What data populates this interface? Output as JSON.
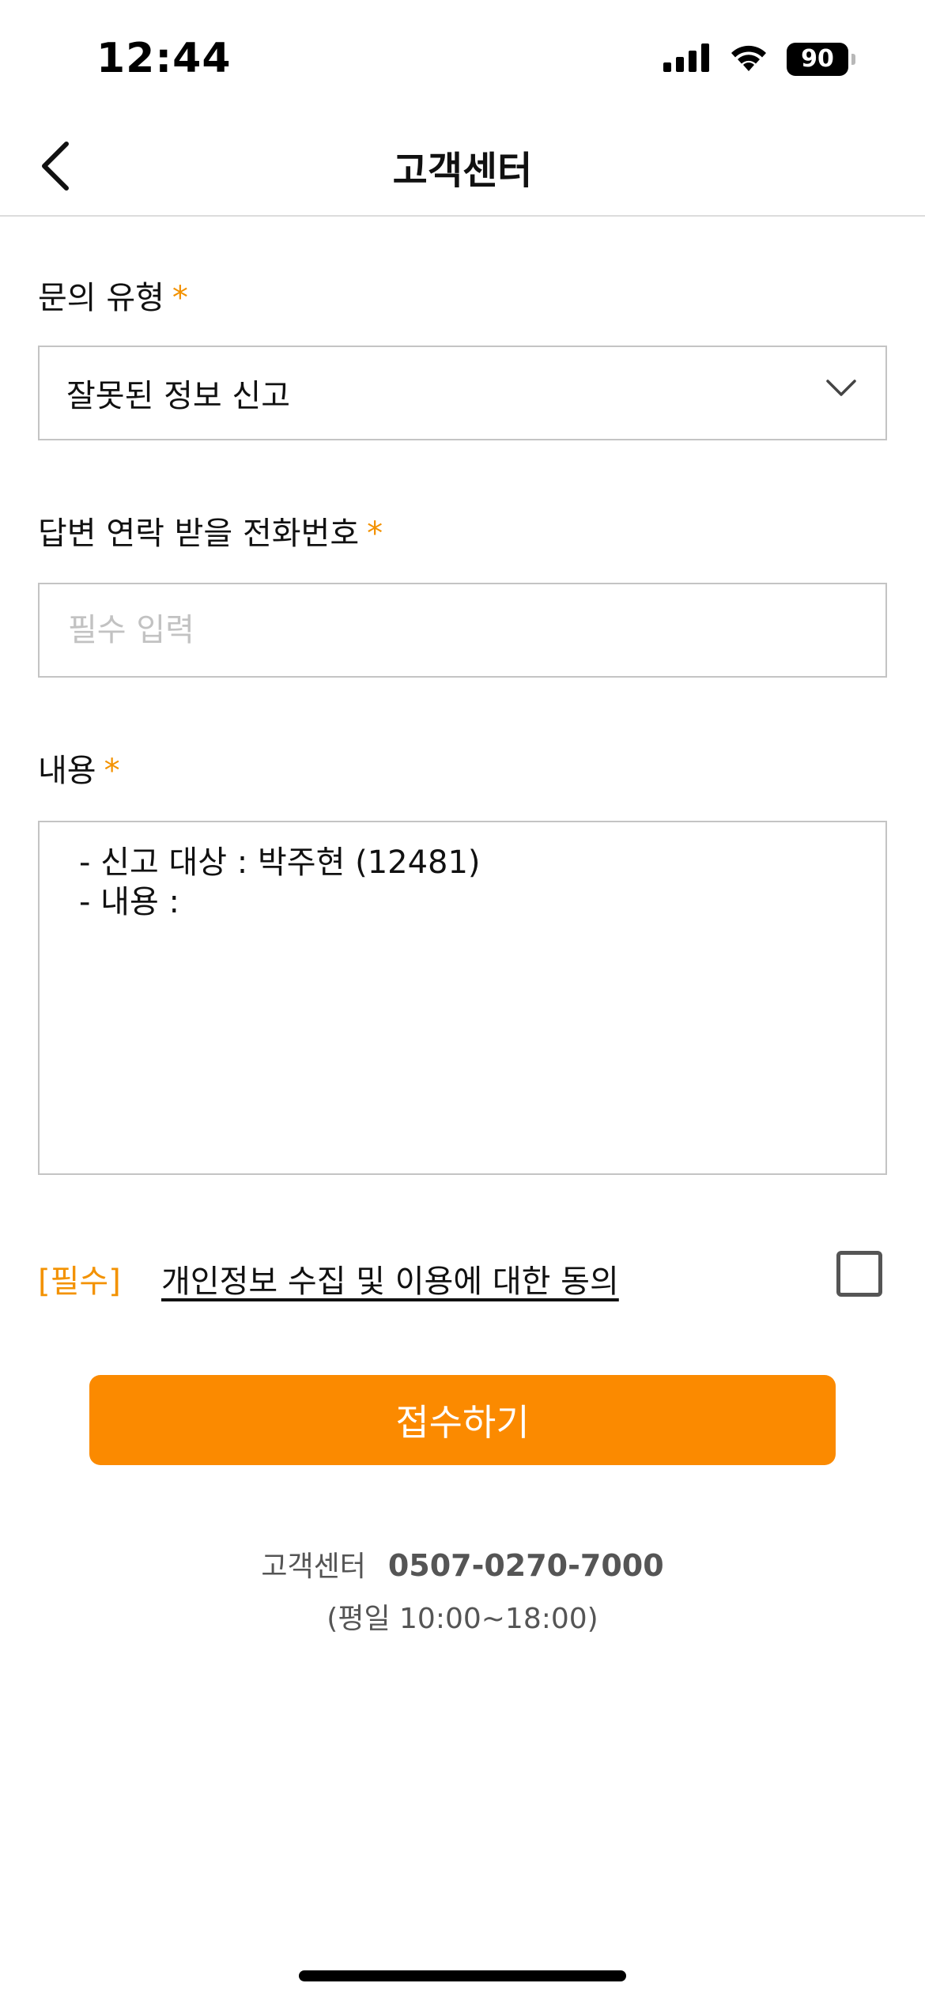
{
  "status_bar": {
    "time": "12:44",
    "battery": "90",
    "icons": [
      "cellular-signal-icon",
      "wifi-icon",
      "battery-icon"
    ]
  },
  "header": {
    "title": "고객센터",
    "back_icon": "chevron-left-icon"
  },
  "form": {
    "inquiry_type": {
      "label": "문의 유형",
      "required_mark": "*",
      "selected_value": "잘못된 정보 신고",
      "dropdown_icon": "chevron-down-icon"
    },
    "phone": {
      "label": "답변 연락 받을 전화번호",
      "required_mark": "*",
      "value": "",
      "placeholder": "필수 입력"
    },
    "content": {
      "label": "내용",
      "required_mark": "*",
      "value": "- 신고 대상 : 박주현 (12481)\n- 내용 :"
    }
  },
  "consent": {
    "required_tag": "[필수]",
    "link_text": "개인정보 수집 및 이용에 대한 동의",
    "checked": false
  },
  "submit": {
    "label": "접수하기"
  },
  "customer_service": {
    "label": "고객센터",
    "phone": "0507-0270-7000",
    "hours": "(평일 10:00~18:00)"
  },
  "colors": {
    "accent": "#fb8a00",
    "required": "#f39200",
    "border": "#c4c4c4",
    "placeholder": "#c2c2c2"
  }
}
